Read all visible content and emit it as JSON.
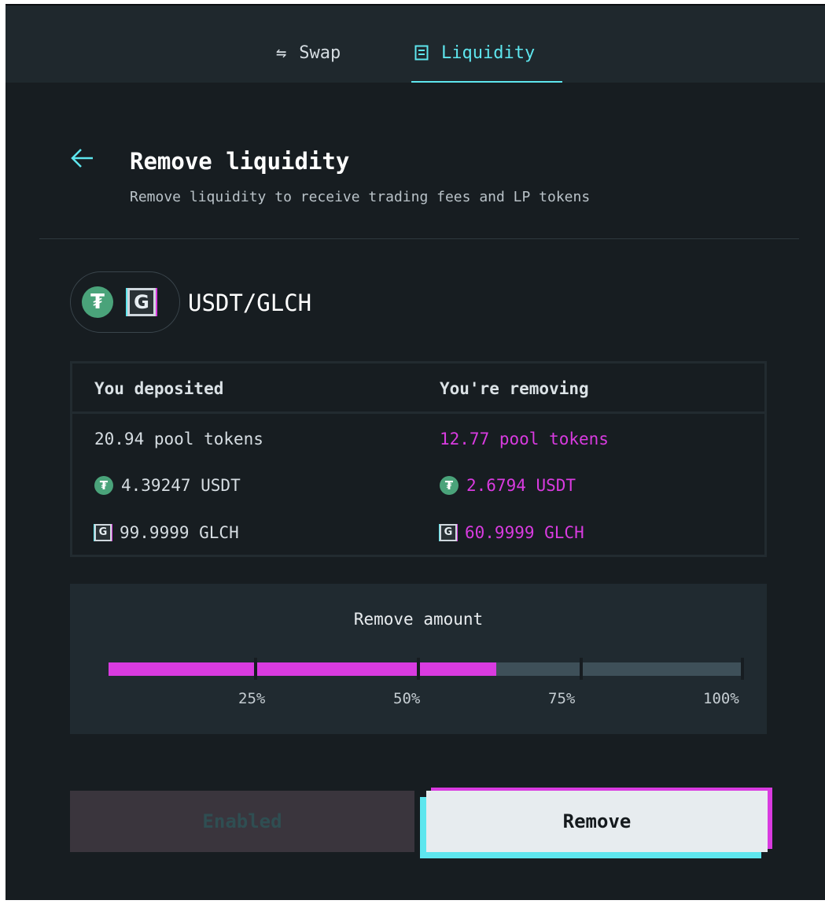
{
  "tabs": [
    {
      "label": "Swap",
      "icon": "swap-arrows-icon",
      "active": false
    },
    {
      "label": "Liquidity",
      "icon": "liquidity-icon",
      "active": true
    }
  ],
  "header": {
    "title": "Remove liquidity",
    "subtitle": "Remove liquidity to receive trading fees and LP tokens"
  },
  "pair": {
    "name": "USDT/GLCH",
    "token_a_symbol": "₮",
    "token_b_symbol": "G"
  },
  "table": {
    "deposited_header": "You deposited",
    "removing_header": "You're removing",
    "deposited": {
      "pool_tokens": "20.94 pool tokens",
      "usdt": "4.39247 USDT",
      "glch": "99.9999 GLCH"
    },
    "removing": {
      "pool_tokens": "12.77 pool tokens",
      "usdt": "2.6794 USDT",
      "glch": "60.9999 GLCH"
    }
  },
  "slider": {
    "title": "Remove amount",
    "value_fraction": 0.61,
    "tick_labels": [
      "25%",
      "50%",
      "75%",
      "100%"
    ]
  },
  "buttons": {
    "enabled_label": "Enabled",
    "remove_label": "Remove"
  },
  "colors": {
    "accent_cyan": "#5ee6ee",
    "accent_magenta": "#d93be0",
    "usdt_green": "#4aa37a",
    "background": "#171d21"
  }
}
